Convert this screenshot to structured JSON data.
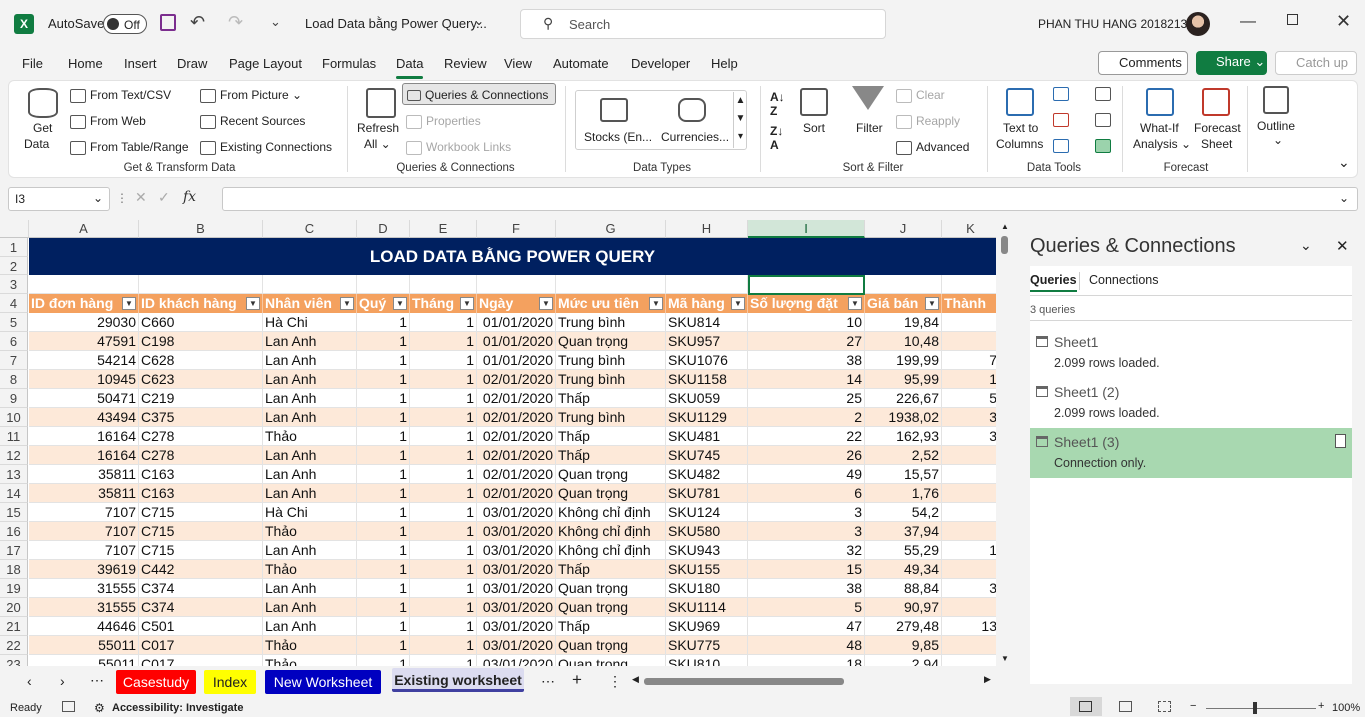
{
  "titlebar": {
    "autosave_label": "AutoSave",
    "autosave_state": "Off",
    "doc_title": "Load Data bằng Power Query...",
    "search_placeholder": "Search",
    "user_name": "PHAN THU HANG 20182137"
  },
  "menu": {
    "items": [
      "File",
      "Home",
      "Insert",
      "Draw",
      "Page Layout",
      "Formulas",
      "Data",
      "Review",
      "View",
      "Automate",
      "Developer",
      "Help"
    ],
    "active": "Data",
    "comments": "Comments",
    "share": "Share",
    "catchup": "Catch up"
  },
  "ribbon": {
    "get_data": "Get",
    "get_data2": "Data",
    "from_text": "From Text/CSV",
    "from_web": "From Web",
    "from_table": "From Table/Range",
    "from_picture": "From Picture",
    "recent_sources": "Recent Sources",
    "existing_conn": "Existing Connections",
    "group_get": "Get & Transform Data",
    "refresh": "Refresh",
    "refresh2": "All",
    "queries_conn": "Queries & Connections",
    "properties": "Properties",
    "workbook_links": "Workbook Links",
    "group_queries": "Queries & Connections",
    "stocks": "Stocks (En...",
    "currencies": "Currencies...",
    "group_types": "Data Types",
    "sort": "Sort",
    "filter": "Filter",
    "clear": "Clear",
    "reapply": "Reapply",
    "advanced": "Advanced",
    "group_sort": "Sort & Filter",
    "text_to_columns": "Text to",
    "text_to_columns2": "Columns",
    "group_tools": "Data Tools",
    "whatif": "What-If",
    "whatif2": "Analysis",
    "forecast_sheet": "Forecast",
    "forecast_sheet2": "Sheet",
    "group_forecast": "Forecast",
    "outline": "Outline"
  },
  "formula_bar": {
    "cell_ref": "I3",
    "value": ""
  },
  "sheet": {
    "col_letters": [
      "A",
      "B",
      "C",
      "D",
      "E",
      "F",
      "G",
      "H",
      "I",
      "J",
      "K"
    ],
    "row_numbers": [
      "1",
      "2",
      "3",
      "4",
      "5",
      "6",
      "7",
      "8",
      "9",
      "10",
      "11",
      "12",
      "13",
      "14",
      "15",
      "16",
      "17",
      "18",
      "19",
      "20",
      "21",
      "22",
      "23"
    ],
    "title": "LOAD DATA BẰNG POWER QUERY",
    "headers": [
      "ID đơn hàng",
      "ID khách hàng",
      "Nhân viên",
      "Quý",
      "Tháng",
      "Ngày",
      "Mức ưu tiên",
      "Mã hàng",
      "Số lượng đặt",
      "Giá bán",
      "Thành"
    ],
    "rows": [
      [
        "29030",
        "C660",
        "Hà Chi",
        "1",
        "1",
        "01/01/2020",
        "Trung bình",
        "SKU814",
        "10",
        "19,84",
        ""
      ],
      [
        "47591",
        "C198",
        "Lan Anh",
        "1",
        "1",
        "01/01/2020",
        "Quan trọng",
        "SKU957",
        "27",
        "10,48",
        ""
      ],
      [
        "54214",
        "C628",
        "Lan Anh",
        "1",
        "1",
        "01/01/2020",
        "Trung bình",
        "SKU1076",
        "38",
        "199,99",
        "7"
      ],
      [
        "10945",
        "C623",
        "Lan Anh",
        "1",
        "1",
        "02/01/2020",
        "Trung bình",
        "SKU1158",
        "14",
        "95,99",
        "1"
      ],
      [
        "50471",
        "C219",
        "Lan Anh",
        "1",
        "1",
        "02/01/2020",
        "Thấp",
        "SKU059",
        "25",
        "226,67",
        "5"
      ],
      [
        "43494",
        "C375",
        "Lan Anh",
        "1",
        "1",
        "02/01/2020",
        "Trung bình",
        "SKU1129",
        "2",
        "1938,02",
        "3"
      ],
      [
        "16164",
        "C278",
        "Thảo",
        "1",
        "1",
        "02/01/2020",
        "Thấp",
        "SKU481",
        "22",
        "162,93",
        "3"
      ],
      [
        "16164",
        "C278",
        "Lan Anh",
        "1",
        "1",
        "02/01/2020",
        "Thấp",
        "SKU745",
        "26",
        "2,52",
        ""
      ],
      [
        "35811",
        "C163",
        "Lan Anh",
        "1",
        "1",
        "02/01/2020",
        "Quan trọng",
        "SKU482",
        "49",
        "15,57",
        ""
      ],
      [
        "35811",
        "C163",
        "Lan Anh",
        "1",
        "1",
        "02/01/2020",
        "Quan trọng",
        "SKU781",
        "6",
        "1,76",
        ""
      ],
      [
        "7107",
        "C715",
        "Hà Chi",
        "1",
        "1",
        "03/01/2020",
        "Không chỉ định",
        "SKU124",
        "3",
        "54,2",
        ""
      ],
      [
        "7107",
        "C715",
        "Thảo",
        "1",
        "1",
        "03/01/2020",
        "Không chỉ định",
        "SKU580",
        "3",
        "37,94",
        ""
      ],
      [
        "7107",
        "C715",
        "Lan Anh",
        "1",
        "1",
        "03/01/2020",
        "Không chỉ định",
        "SKU943",
        "32",
        "55,29",
        "1"
      ],
      [
        "39619",
        "C442",
        "Thảo",
        "1",
        "1",
        "03/01/2020",
        "Thấp",
        "SKU155",
        "15",
        "49,34",
        ""
      ],
      [
        "31555",
        "C374",
        "Lan Anh",
        "1",
        "1",
        "03/01/2020",
        "Quan trọng",
        "SKU180",
        "38",
        "88,84",
        "3"
      ],
      [
        "31555",
        "C374",
        "Lan Anh",
        "1",
        "1",
        "03/01/2020",
        "Quan trọng",
        "SKU1114",
        "5",
        "90,97",
        ""
      ],
      [
        "44646",
        "C501",
        "Lan Anh",
        "1",
        "1",
        "03/01/2020",
        "Thấp",
        "SKU969",
        "47",
        "279,48",
        "13"
      ],
      [
        "55011",
        "C017",
        "Thảo",
        "1",
        "1",
        "03/01/2020",
        "Quan trọng",
        "SKU775",
        "48",
        "9,85",
        ""
      ],
      [
        "55011",
        "C017",
        "Thảo",
        "1",
        "1",
        "03/01/2020",
        "Quan trọng",
        "SKU810",
        "18",
        "2,94",
        ""
      ]
    ]
  },
  "tabs": [
    {
      "label": "Casestudy",
      "bg": "#ff0000",
      "fg": "#ffffff"
    },
    {
      "label": "Index",
      "bg": "#ffff00",
      "fg": "#222222"
    },
    {
      "label": "New Worksheet",
      "bg": "#0000c0",
      "fg": "#ffffff"
    },
    {
      "label": "Existing worksheet",
      "bg": "#dcdcf0",
      "fg": "#222222"
    }
  ],
  "status": {
    "ready": "Ready",
    "accessibility": "Accessibility: Investigate",
    "zoom": "100%"
  },
  "pane": {
    "title": "Queries & Connections",
    "tab_queries": "Queries",
    "tab_connections": "Connections",
    "count": "3 queries",
    "queries": [
      {
        "name": "Sheet1",
        "status": "2.099 rows loaded."
      },
      {
        "name": "Sheet1 (2)",
        "status": "2.099 rows loaded."
      },
      {
        "name": "Sheet1 (3)",
        "status": "Connection only."
      }
    ]
  },
  "colors": {
    "accent": "#107c41",
    "title_bg": "#002060",
    "header_bg": "#f4a15f",
    "band": "#fde9d9",
    "selected_query": "#a8d8b0"
  }
}
